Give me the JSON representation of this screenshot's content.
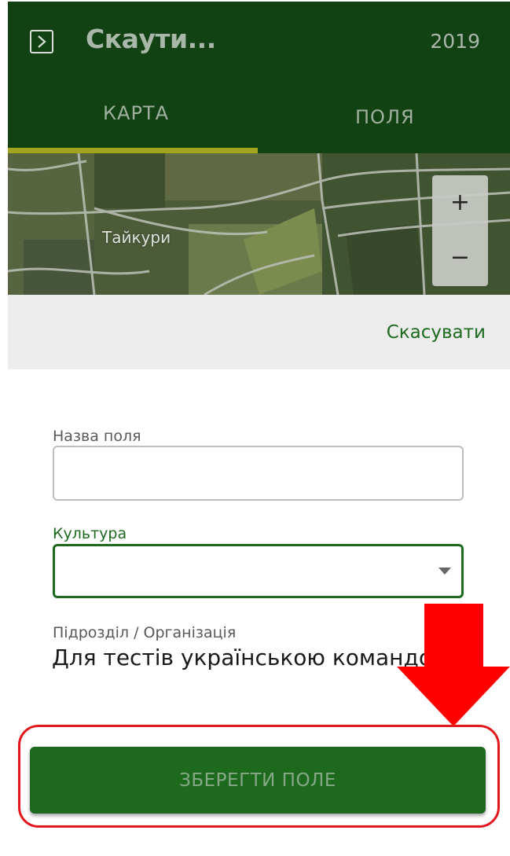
{
  "app_bar": {
    "title": "Скаути...",
    "year": "2019",
    "tabs": [
      {
        "label": "КАРТА",
        "active": true
      },
      {
        "label": "ПОЛЯ",
        "active": false
      }
    ]
  },
  "map": {
    "place_label": "Тайкури",
    "zoom_in": "+",
    "zoom_out": "−"
  },
  "cancel_label": "Скасувати",
  "form": {
    "field_name": {
      "label": "Назва поля",
      "value": ""
    },
    "crop": {
      "label": "Культура",
      "value": ""
    },
    "org": {
      "label": "Підрозділ / Організація",
      "value": "Для тестів українською командою"
    }
  },
  "save_button": {
    "label": "ЗБЕРЕГТИ ПОЛЕ"
  },
  "colors": {
    "app_bar": "#124214",
    "accent": "#1d6a1f",
    "tab_indicator": "#a2a41f",
    "annotation": "#e2161c"
  },
  "icons": {
    "menu": "chevron-right-icon",
    "dropdown": "dropdown-triangle-icon",
    "annotation": "arrow-down-icon"
  }
}
